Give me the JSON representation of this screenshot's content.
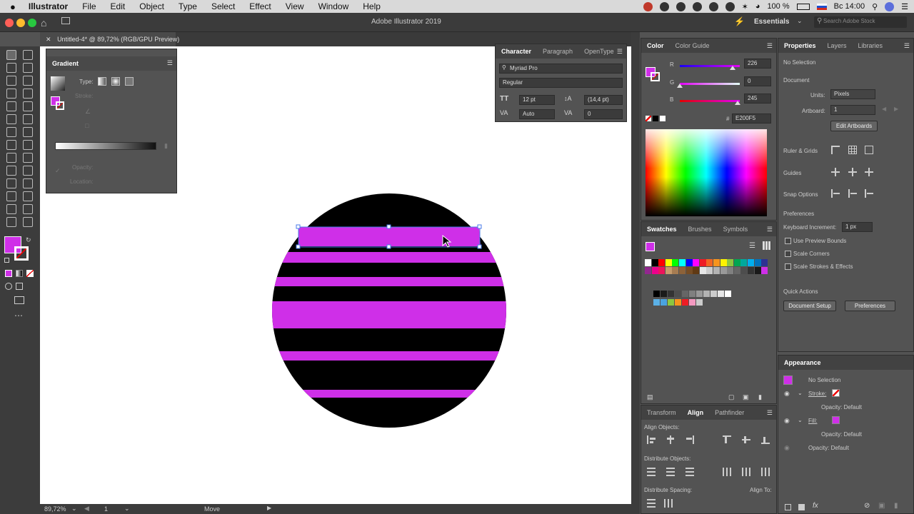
{
  "menubar": {
    "app": "Illustrator",
    "items": [
      "File",
      "Edit",
      "Object",
      "Type",
      "Select",
      "Effect",
      "View",
      "Window",
      "Help"
    ],
    "battery": "100 %",
    "clock": "Вс 14:00"
  },
  "window": {
    "title": "Adobe Illustrator 2019",
    "workspace": "Essentials",
    "search_placeholder": "Search Adobe Stock"
  },
  "document": {
    "tab": "Untitled-4* @ 89,72% (RGB/GPU Preview)"
  },
  "status": {
    "zoom": "89,72%",
    "artboard": "1",
    "tool": "Move"
  },
  "gradient_panel": {
    "title": "Gradient",
    "type_label": "Type:",
    "stroke_label": "Stroke:",
    "opacity_label": "Opacity:",
    "location_label": "Location:"
  },
  "character_panel": {
    "tabs": [
      "Character",
      "Paragraph",
      "OpenType"
    ],
    "font": "Myriad Pro",
    "style": "Regular",
    "size": "12 pt",
    "leading": "(14,4 pt)",
    "kerning": "Auto",
    "tracking": "0"
  },
  "color_panel": {
    "tabs": [
      "Color",
      "Color Guide"
    ],
    "r_label": "R",
    "g_label": "G",
    "b_label": "B",
    "r": "226",
    "g": "0",
    "b": "245",
    "r_value": 226,
    "g_value": 0,
    "b_value": 245,
    "hex_prefix": "#",
    "hex": "E200F5"
  },
  "swatches_panel": {
    "tabs": [
      "Swatches",
      "Brushes",
      "Symbols"
    ]
  },
  "align_panel": {
    "tabs": [
      "Transform",
      "Align",
      "Pathfinder"
    ],
    "align_objects": "Align Objects:",
    "distribute_objects": "Distribute Objects:",
    "distribute_spacing": "Distribute Spacing:",
    "align_to": "Align To:"
  },
  "properties_panel": {
    "tabs": [
      "Properties",
      "Layers",
      "Libraries"
    ],
    "selection": "No Selection",
    "document_label": "Document",
    "units_label": "Units:",
    "units": "Pixels",
    "artboard_label": "Artboard:",
    "artboard": "1",
    "edit_artboards": "Edit Artboards",
    "ruler_grids": "Ruler & Grids",
    "guides": "Guides",
    "snap_options": "Snap Options",
    "preferences_label": "Preferences",
    "keyboard_increment_label": "Keyboard Increment:",
    "keyboard_increment": "1 px",
    "use_preview_bounds": "Use Preview Bounds",
    "scale_corners": "Scale Corners",
    "scale_strokes": "Scale Strokes & Effects",
    "quick_actions": "Quick Actions",
    "document_setup": "Document Setup",
    "preferences_button": "Preferences"
  },
  "appearance_panel": {
    "title": "Appearance",
    "selection": "No Selection",
    "stroke_label": "Stroke:",
    "fill_label": "Fill:",
    "opacity_default": "Opacity: Default"
  },
  "colors": {
    "accent": "#CF2FE8",
    "stripe_black": "#000000",
    "ui_dark": "#535353"
  }
}
